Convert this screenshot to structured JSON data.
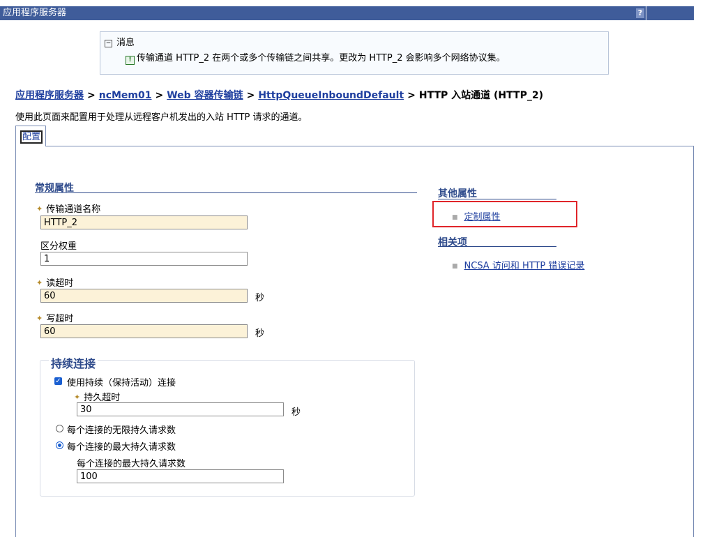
{
  "titlebar": {
    "title": "应用程序服务器",
    "help": "?"
  },
  "message": {
    "heading": "消息",
    "collapse_icon": "⊟",
    "text": "传输通道 HTTP_2 在两个或多个传输链之间共享。更改为 HTTP_2 会影响多个网络协议集。"
  },
  "breadcrumb": {
    "items": [
      "应用程序服务器",
      "ncMem01",
      "Web 容器传输链",
      "HttpQueueInboundDefault"
    ],
    "current": "HTTP 入站通道 (HTTP_2)",
    "separator": ">"
  },
  "description": "使用此页面来配置用于处理从远程客户机发出的入站 HTTP 请求的通道。",
  "tab": {
    "label": "配置"
  },
  "general": {
    "heading": "常规属性",
    "fields": {
      "name": {
        "label": "传输通道名称",
        "value": "HTTP_2",
        "required": true
      },
      "weight": {
        "label": "区分权重",
        "value": "1",
        "required": false
      },
      "read_timeout": {
        "label": "读超时",
        "value": "60",
        "unit": "秒",
        "required": true
      },
      "write_timeout": {
        "label": "写超时",
        "value": "60",
        "unit": "秒",
        "required": true
      }
    }
  },
  "persistent": {
    "heading": "持续连接",
    "use_persistent": {
      "label": "使用持续（保持活动）连接",
      "checked": true
    },
    "timeout": {
      "label": "持久超时",
      "value": "30",
      "unit": "秒",
      "required": true
    },
    "unlimited": {
      "label": "每个连接的无限持久请求数",
      "selected": false
    },
    "maximum": {
      "label": "每个连接的最大持久请求数",
      "selected": true
    },
    "max_requests": {
      "label": "每个连接的最大持久请求数",
      "value": "100"
    }
  },
  "other_properties": {
    "heading": "其他属性",
    "links": [
      "定制属性"
    ]
  },
  "related": {
    "heading": "相关项",
    "links": [
      "NCSA 访问和 HTTP 错误记录"
    ]
  },
  "required_marker": "✦",
  "colors": {
    "titlebar": "#3f5c9a",
    "link": "#1f3f9f",
    "section": "#2e4a8b",
    "required_field": "#fcf2d8",
    "highlight": "#e0252a"
  }
}
